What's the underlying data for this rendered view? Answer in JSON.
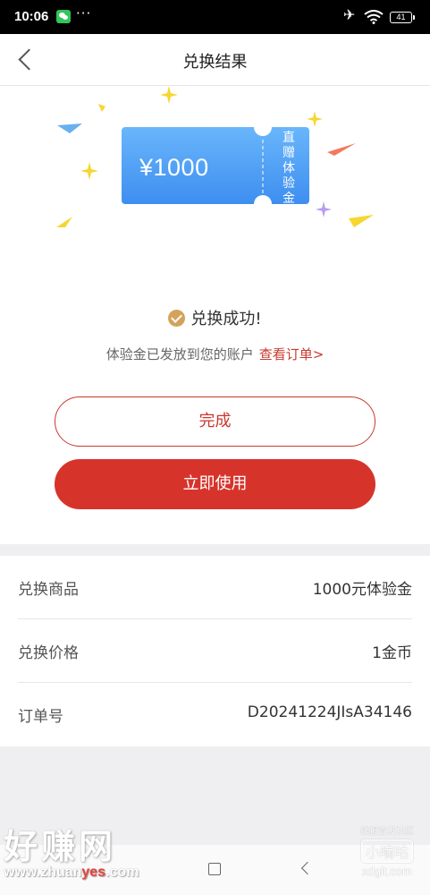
{
  "status_bar": {
    "time": "10:06",
    "more": "···",
    "battery": "41"
  },
  "header": {
    "title": "兑换结果"
  },
  "voucher": {
    "amount": "¥1000",
    "side_text": "直赠体验金"
  },
  "result": {
    "status": "兑换成功!",
    "info": "体验金已发放到您的账户",
    "view_order": "查看订单>"
  },
  "actions": {
    "done": "完成",
    "use_now": "立即使用"
  },
  "details": [
    {
      "label": "兑换商品",
      "value": "1000元体验金"
    },
    {
      "label": "兑换价格",
      "value": "1金币"
    },
    {
      "label": "订单号",
      "value": "D20241224JIsA34146"
    }
  ],
  "watermark": {
    "logo": "好赚网",
    "url_prefix": "www.zhuan",
    "url_accent": "yes",
    "url_suffix": ".com",
    "right_small": "线报首发社区",
    "right_badge": "小嘀咕",
    "right_domain": "xdgit.com"
  },
  "colors": {
    "accent": "#d6342b",
    "ticket_blue": "#4a9cf5",
    "gold": "#d3a35c"
  }
}
